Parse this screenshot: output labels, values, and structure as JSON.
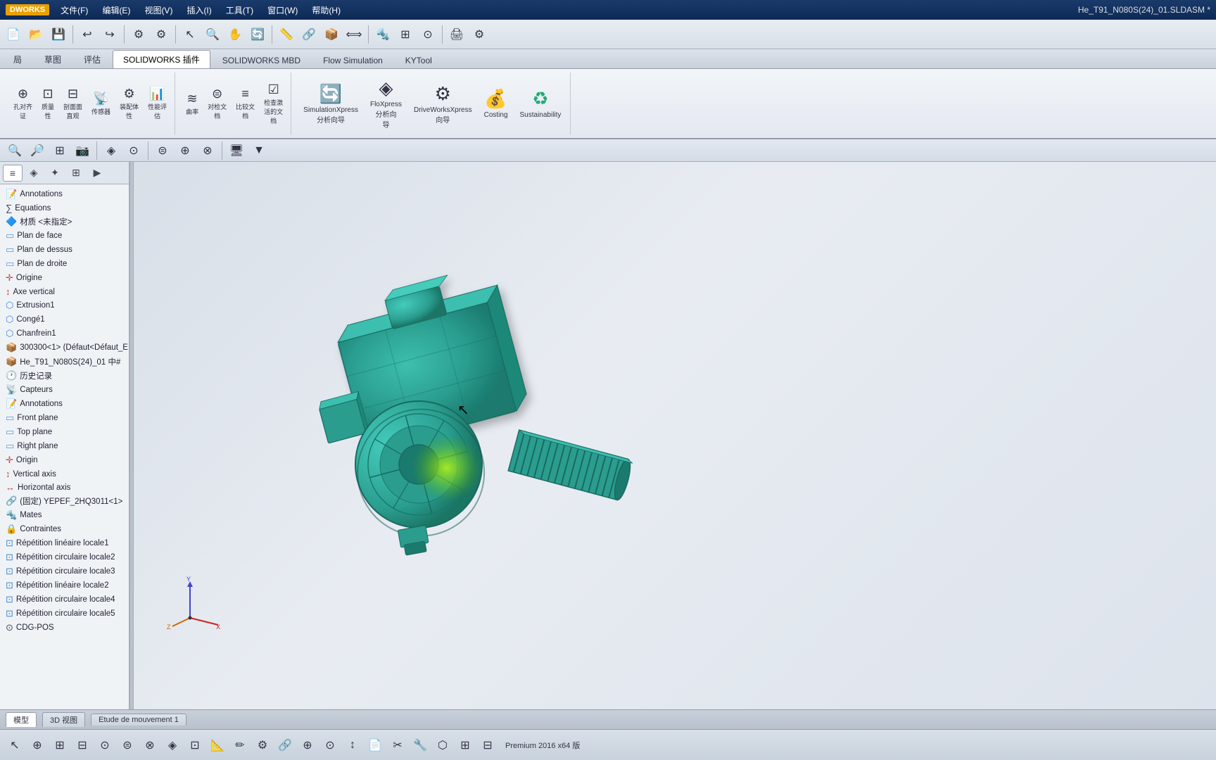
{
  "titlebar": {
    "logo": "DWORKS",
    "menu": [
      "文件(F)",
      "编辑(E)",
      "视图(V)",
      "插入(I)",
      "工具(T)",
      "窗口(W)",
      "帮助(H)"
    ],
    "title": "He_T91_N080S(24)_01.SLDASM *"
  },
  "ribbon_tabs": [
    "局",
    "草图",
    "评估",
    "SOLIDWORKS 插件",
    "SOLIDWORKS MBD",
    "Flow Simulation",
    "KYTool"
  ],
  "ribbon_groups": [
    {
      "buttons": [
        {
          "icon": "⊞",
          "label": "孔对齐\n证"
        },
        {
          "icon": "⊡",
          "label": "质量\n性"
        },
        {
          "icon": "⊟",
          "label": "剖面面\n直观"
        },
        {
          "icon": "⊙",
          "label": "传感器"
        },
        {
          "icon": "⊕",
          "label": "装配体\n性"
        },
        {
          "icon": "⊗",
          "label": "性能评\n估"
        }
      ]
    },
    {
      "buttons": [
        {
          "icon": "≋",
          "label": "曲率"
        },
        {
          "icon": "⊜",
          "label": "对检文\n档"
        },
        {
          "icon": "≡",
          "label": "比较文\n档"
        },
        {
          "icon": "☑",
          "label": "检查激\n活的文\n档"
        }
      ]
    },
    {
      "buttons": [
        {
          "icon": "🔄",
          "label": "SimulationXpress\n分析向导"
        },
        {
          "icon": "◈",
          "label": "FloXpress\n分析向\n导"
        },
        {
          "icon": "⚙",
          "label": "DriveWorksXpress\n向导"
        },
        {
          "icon": "💰",
          "label": "Costing"
        },
        {
          "icon": "♻",
          "label": "Sustainability"
        }
      ]
    }
  ],
  "panel_tabs": [
    {
      "icon": "≡",
      "active": true
    },
    {
      "icon": "◈"
    },
    {
      "icon": "✦"
    },
    {
      "icon": "⊞"
    }
  ],
  "tree_items": [
    {
      "icon": "📝",
      "label": "Annotations"
    },
    {
      "icon": "∑",
      "label": "Equations"
    },
    {
      "icon": "🔷",
      "label": "材质 <未指定>"
    },
    {
      "icon": "▭",
      "label": "Plan de face"
    },
    {
      "icon": "▭",
      "label": "Plan de dessus"
    },
    {
      "icon": "▭",
      "label": "Plan de droite"
    },
    {
      "icon": "✛",
      "label": "Origine"
    },
    {
      "icon": "↕",
      "label": "Axe vertical"
    },
    {
      "icon": "⬡",
      "label": "Extrusion1"
    },
    {
      "icon": "⬡",
      "label": "Congé1"
    },
    {
      "icon": "⬡",
      "label": "Chanfrein1"
    },
    {
      "icon": "📦",
      "label": "300300<1> (Défaut<Défaut_E"
    },
    {
      "icon": "📦",
      "label": "He_T91_N080S(24)_01 中#"
    },
    {
      "icon": "🕐",
      "label": "历史记录"
    },
    {
      "icon": "📡",
      "label": "Capteurs"
    },
    {
      "icon": "📝",
      "label": "Annotations"
    },
    {
      "icon": "▭",
      "label": "Front plane"
    },
    {
      "icon": "▭",
      "label": "Top plane"
    },
    {
      "icon": "▭",
      "label": "Right plane"
    },
    {
      "icon": "✛",
      "label": "Origin"
    },
    {
      "icon": "↕",
      "label": "Vertical axis"
    },
    {
      "icon": "↔",
      "label": "Horizontal axis"
    },
    {
      "icon": "🔗",
      "label": "(固定) YEPEF_2HQ3011<1>"
    },
    {
      "icon": "🔩",
      "label": "Mates"
    },
    {
      "icon": "🔒",
      "label": "Contraintes"
    },
    {
      "icon": "⊡",
      "label": "Répétition linéaire locale1"
    },
    {
      "icon": "⊡",
      "label": "Répétition circulaire locale2"
    },
    {
      "icon": "⊡",
      "label": "Répétition circulaire locale3"
    },
    {
      "icon": "⊡",
      "label": "Répétition linéaire locale2"
    },
    {
      "icon": "⊡",
      "label": "Répétition circulaire locale4"
    },
    {
      "icon": "⊡",
      "label": "Répétition circulaire locale5"
    },
    {
      "icon": "⊙",
      "label": "CDG-POS"
    }
  ],
  "status_tabs": [
    "模型",
    "3D 视图",
    "Etude de mouvement 1"
  ],
  "bottom_status": "Premium 2016 x64 版",
  "toolbar2_icons": [
    "🔍",
    "📐",
    "⊞",
    "◈",
    "⊟",
    "⚙",
    "⊕",
    "⊗"
  ],
  "secondary_toolbar_icons": [
    "🔍",
    "🔎",
    "⊞",
    "📷",
    "◈",
    "⊙",
    "⊜",
    "⊕",
    "⊗",
    "⊟"
  ],
  "colors": {
    "model_teal": "#2a9d8f",
    "model_dark": "#1a7a6e",
    "glow_green": "#aaff00",
    "bg_gradient_start": "#d8dfe8",
    "bg_gradient_end": "#e8ecf2"
  }
}
